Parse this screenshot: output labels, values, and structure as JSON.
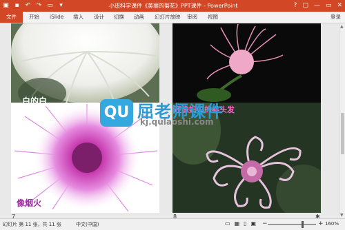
{
  "window": {
    "title": "小班科学课件《美丽的菊花》PPT课件 - PowerPoint",
    "controls": [
      "?",
      "▢",
      "—",
      "▭",
      "✕"
    ]
  },
  "qat": [
    "save-icon",
    "undo-icon",
    "redo-icon",
    "present-icon"
  ],
  "ribbon": {
    "tabs": [
      "文件",
      "开始",
      "iSlide",
      "插入",
      "设计",
      "切换",
      "动画",
      "幻灯片放映",
      "审阅",
      "视图"
    ],
    "login": "登录"
  },
  "slides": [
    {
      "number": "5",
      "caption": "白的白"
    },
    {
      "number": "6",
      "caption": ""
    },
    {
      "number": "7",
      "caption": "像烟火"
    },
    {
      "number": "8",
      "caption": "还像妈妈的卷头发"
    }
  ],
  "watermark": {
    "logo": "QU",
    "brand": "屈老师课件",
    "url": "kj.qulaoshi.com"
  },
  "status": {
    "slide_info": "幻灯片 第 11 张，共 11 张",
    "language": "中文(中国)",
    "zoom": "160%",
    "zoom_minus": "−",
    "zoom_plus": "+",
    "zoom_level": 0.72
  },
  "colors": {
    "accent": "#d24726",
    "slide7_caption": "#9b2fa0",
    "slide8_caption": "#ff66cc"
  }
}
